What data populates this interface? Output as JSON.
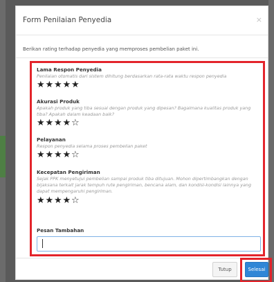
{
  "modal": {
    "title": "Form Penilaian Penyedia",
    "close_glyph": "×",
    "intro": "Berikan rating terhadap penyedia yang memproses pembelian paket ini."
  },
  "sections": [
    {
      "label": "Lama Respon Penyedia",
      "description": "Penilaian otomatis dari sistem dihitung berdasarkan rata-rata waktu respon penyedia",
      "rating": 5,
      "max_rating": 5
    },
    {
      "label": "Akurasi Produk",
      "description": "Apakah produk yang tiba sesuai dengan produk yang dipesan? Bagaimana kualitas produk yang tiba? Apakah dalam keadaan baik?",
      "rating": 4,
      "max_rating": 5
    },
    {
      "label": "Pelayanan",
      "description": "Respon penyedia selama proses pembelian paket",
      "rating": 4,
      "max_rating": 5
    },
    {
      "label": "Kecepatan Pengiriman",
      "description": "Sejak PPK menyetujui pembelian sampai produk tiba ditujuan. Mohon dipertimbangkan dengan bijaksana terkait jarak tempuh rute pengiriman, bencana alam, dan kondisi-kondisi lainnya yang dapat mempengaruhi pengiriman.",
      "rating": 4,
      "max_rating": 5
    }
  ],
  "note": {
    "label": "Pesan Tambahan",
    "value": ""
  },
  "footer": {
    "cancel_label": "Tutup",
    "submit_label": "Selesai"
  },
  "colors": {
    "highlight": "#e3242b",
    "primary": "#2f86d6",
    "input_border": "#7fb2e5"
  },
  "icons": {
    "star_filled": "star-filled-icon",
    "star_empty": "star-outline-icon"
  }
}
